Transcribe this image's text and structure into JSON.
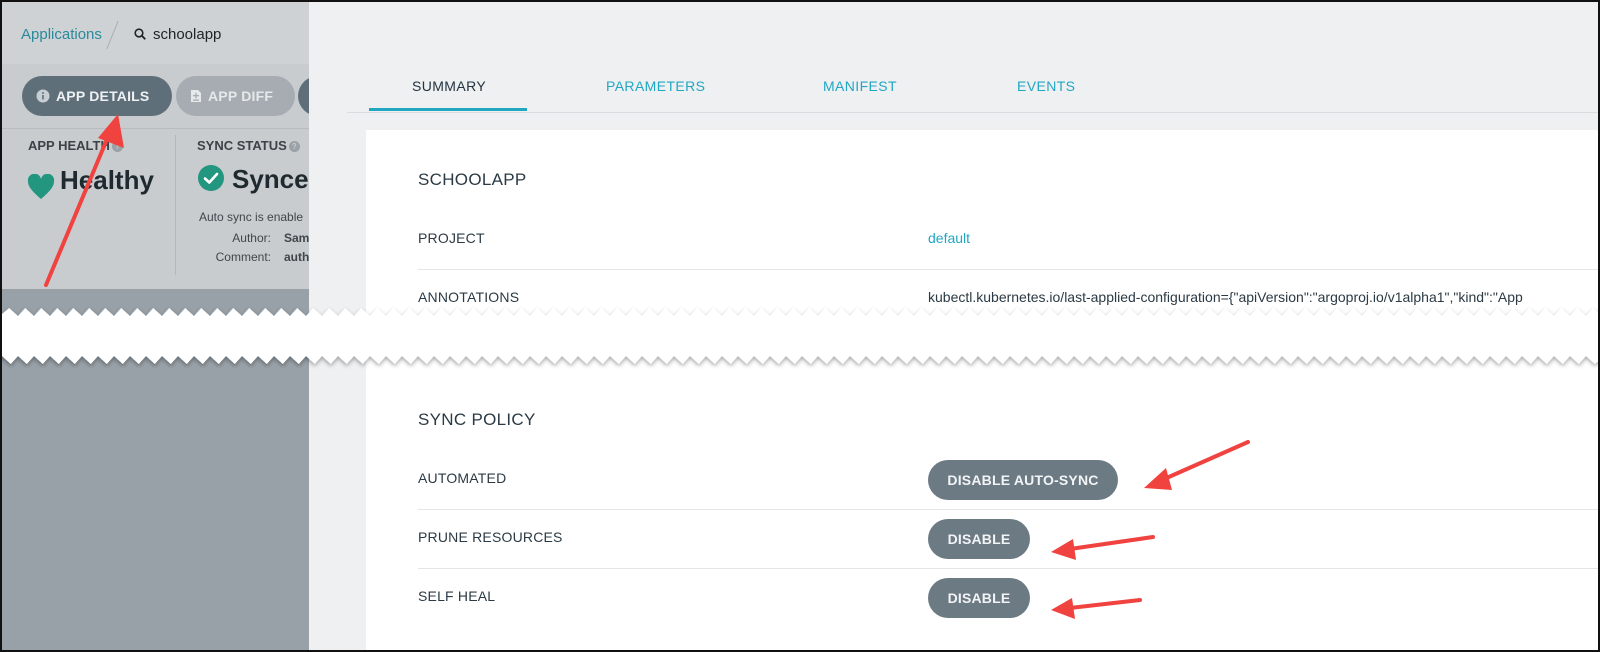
{
  "breadcrumb": {
    "root": "Applications",
    "app": "schoolapp"
  },
  "toolbar": {
    "details_label": "APP DETAILS",
    "diff_label": "APP DIFF"
  },
  "status": {
    "health_label": "APP HEALTH",
    "health_value": "Healthy",
    "sync_label": "SYNC STATUS",
    "sync_value": "Synced",
    "sync_note": "Auto sync is enable",
    "author_key": "Author:",
    "author_val": "Sam",
    "comment_key": "Comment:",
    "comment_val": "auth"
  },
  "tabs": {
    "summary": "SUMMARY",
    "parameters": "PARAMETERS",
    "manifest": "MANIFEST",
    "events": "EVENTS"
  },
  "summary": {
    "title": "SCHOOLAPP",
    "project_label": "PROJECT",
    "project_value": "default",
    "annotations_label": "ANNOTATIONS",
    "annotations_value": "kubectl.kubernetes.io/last-applied-configuration={\"apiVersion\":\"argoproj.io/v1alpha1\",\"kind\":\"App"
  },
  "sync_policy": {
    "title": "SYNC POLICY",
    "automated_label": "AUTOMATED",
    "automated_button": "DISABLE AUTO-SYNC",
    "prune_label": "PRUNE RESOURCES",
    "prune_button": "DISABLE",
    "selfheal_label": "SELF HEAL",
    "selfheal_button": "DISABLE"
  },
  "colors": {
    "accent": "#22a7c2",
    "healthy": "#23967f",
    "button": "#6c7a84",
    "annotation_arrow": "#f0423f"
  }
}
